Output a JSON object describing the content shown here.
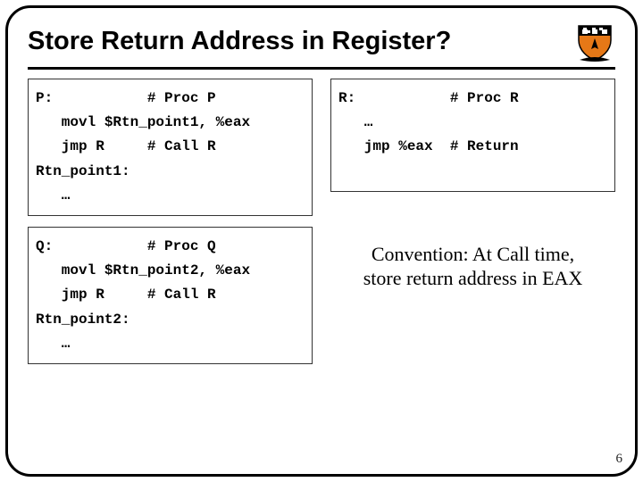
{
  "title": "Store Return Address in Register?",
  "shield": {
    "name": "princeton-shield"
  },
  "codeP": "P:           # Proc P\n   movl $Rtn_point1, %eax\n   jmp R     # Call R\nRtn_point1:\n   …",
  "codeQ": "Q:           # Proc Q\n   movl $Rtn_point2, %eax\n   jmp R     # Call R\nRtn_point2:\n   …",
  "codeR": "R:           # Proc R\n   …\n   jmp %eax  # Return\n\n",
  "caption_line1": "Convention: At Call time,",
  "caption_line2": "store return address in EAX",
  "pagenum": "6"
}
